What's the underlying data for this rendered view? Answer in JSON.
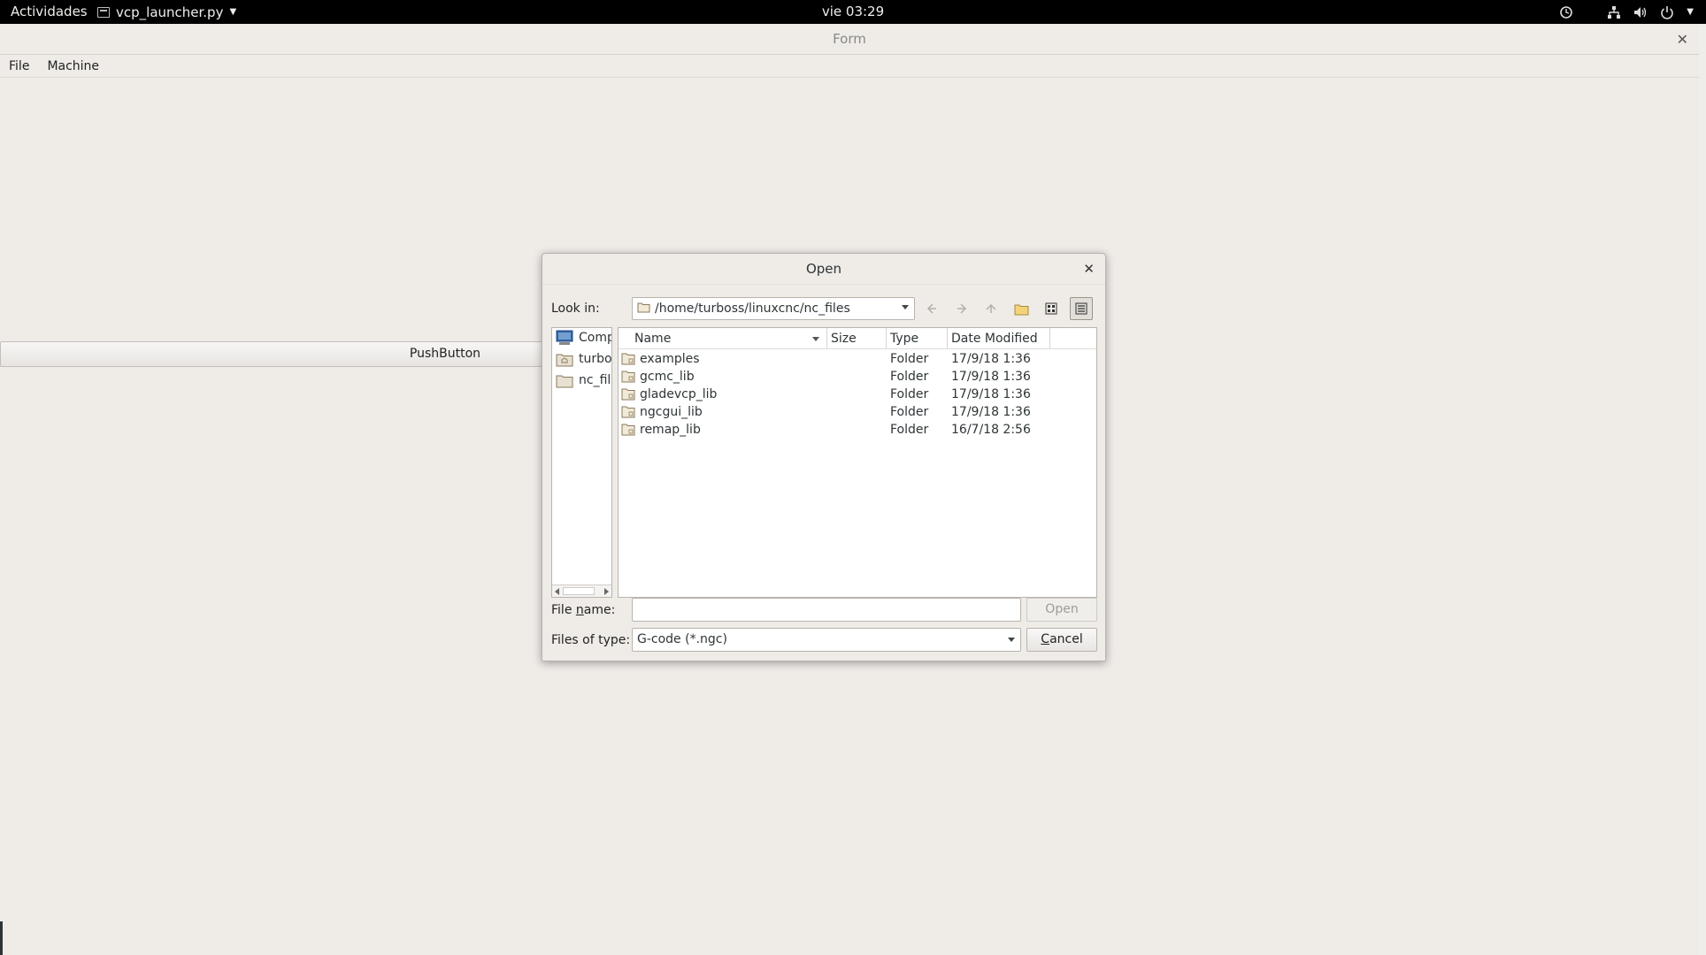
{
  "topbar": {
    "activities": "Actividades",
    "app_name": "vcp_launcher.py",
    "clock": "vie 03:29",
    "tray_icons": [
      "sync-icon",
      "network-icon",
      "volume-icon",
      "power-icon",
      "chevron-down-icon"
    ]
  },
  "main_window": {
    "title": "Form",
    "menu": [
      "File",
      "Machine"
    ],
    "push_button_label": "PushButton"
  },
  "dialog": {
    "title": "Open",
    "look_in_label": "Look in:",
    "look_in_path": "/home/turboss/linuxcnc/nc_files",
    "toolbar_icons": [
      "back-arrow-icon",
      "forward-arrow-icon",
      "up-arrow-icon",
      "new-folder-icon",
      "list-view-icon",
      "detail-view-icon"
    ],
    "sidebar": [
      {
        "label": "Comp",
        "icon": "computer-icon"
      },
      {
        "label": "turbo",
        "icon": "home-folder-icon"
      },
      {
        "label": "nc_fil",
        "icon": "folder-icon"
      }
    ],
    "columns": [
      "Name",
      "Size",
      "Type",
      "Date Modified"
    ],
    "files": [
      {
        "name": "examples",
        "size": "",
        "type": "Folder",
        "date": "17/9/18 1:36"
      },
      {
        "name": "gcmc_lib",
        "size": "",
        "type": "Folder",
        "date": "17/9/18 1:36"
      },
      {
        "name": "gladevcp_lib",
        "size": "",
        "type": "Folder",
        "date": "17/9/18 1:36"
      },
      {
        "name": "ngcgui_lib",
        "size": "",
        "type": "Folder",
        "date": "17/9/18 1:36"
      },
      {
        "name": "remap_lib",
        "size": "",
        "type": "Folder",
        "date": "16/7/18 2:56"
      }
    ],
    "file_name_label_pre": "File ",
    "file_name_label_u": "n",
    "file_name_label_post": "ame:",
    "file_name_value": "",
    "open_label": "Open",
    "files_of_type_label": "Files of type:",
    "files_of_type_value": "G-code (*.ngc)",
    "cancel_label": "Cancel",
    "cancel_u": "C",
    "cancel_rest": "ancel"
  }
}
